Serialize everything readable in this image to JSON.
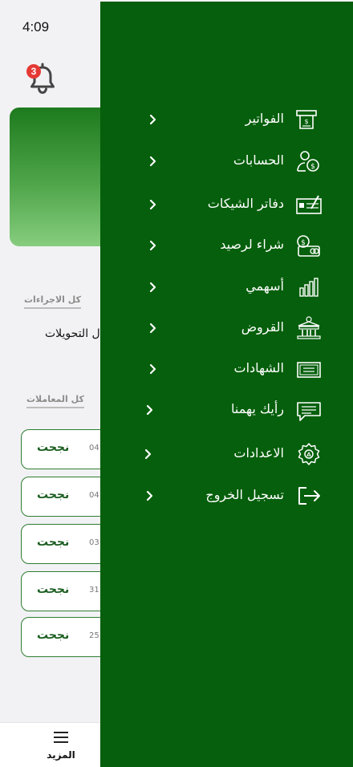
{
  "status_bar": {
    "time": "4:09"
  },
  "notifications": {
    "badge_count": "3"
  },
  "sections": {
    "actions_link": "كل الاجراءات",
    "transfers_label": "ل التحويلات",
    "transactions_link": "كل المعاملات"
  },
  "transactions": [
    {
      "status": "نجحت",
      "date": "04"
    },
    {
      "status": "نجحت",
      "date": "04"
    },
    {
      "status": "نجحت",
      "date": "03"
    },
    {
      "status": "نجحت",
      "date": "31"
    },
    {
      "status": "نجحت",
      "date": "25"
    }
  ],
  "bottom_nav": {
    "more_label": "المزيد"
  },
  "colors": {
    "drawer_bg": "#055f0c",
    "accent_green": "#1b5e20",
    "badge_red": "#e53935"
  },
  "drawer": {
    "items": [
      {
        "label": "الفواتير",
        "icon": "bill-icon"
      },
      {
        "label": "الحسابات",
        "icon": "accounts-icon"
      },
      {
        "label": "دفاتر الشيكات",
        "icon": "checkbook-icon"
      },
      {
        "label": "شراء لرصيد",
        "icon": "buy-credit-icon"
      },
      {
        "label": "أسهمي",
        "icon": "stocks-icon"
      },
      {
        "label": "القروض",
        "icon": "bank-icon"
      },
      {
        "label": "الشهادات",
        "icon": "certificate-icon"
      },
      {
        "label": "رأيك يهمنا",
        "icon": "feedback-icon"
      },
      {
        "label": "الاعدادات",
        "icon": "settings-icon"
      },
      {
        "label": "تسجيل الخروج",
        "icon": "logout-icon"
      }
    ]
  }
}
